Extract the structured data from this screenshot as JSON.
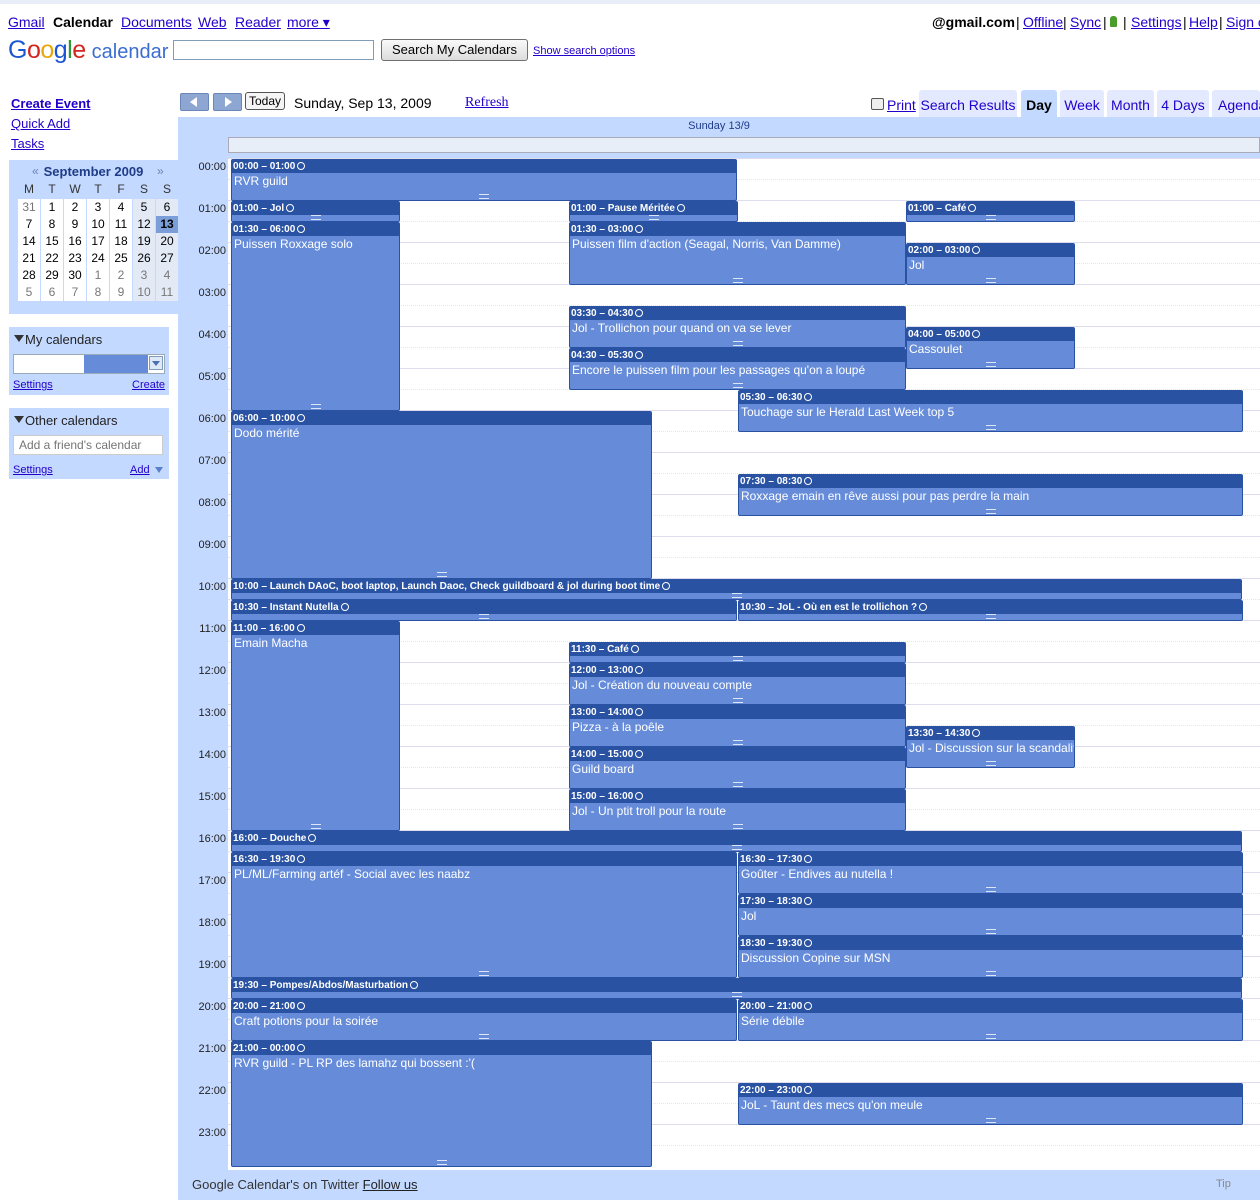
{
  "topbar": {
    "links": [
      "Gmail",
      "Calendar",
      "Documents",
      "Web",
      "Reader",
      "more ▾"
    ],
    "account": "@gmail.com",
    "right_links": [
      "Offline",
      "Sync",
      "Settings",
      "Help",
      "Sign out"
    ]
  },
  "header": {
    "logo_google": [
      "G",
      "o",
      "o",
      "g",
      "l",
      "e"
    ],
    "logo_calendar": "calendar",
    "search_button": "Search My Calendars",
    "show_options": "Show search options"
  },
  "sidebar": {
    "create_event": "Create Event",
    "quick_add": "Quick Add",
    "tasks": "Tasks",
    "minical": {
      "month": "September 2009",
      "prev": "«",
      "next": "»",
      "weekdays": [
        "M",
        "T",
        "W",
        "T",
        "F",
        "S",
        "S"
      ],
      "weeks": [
        [
          "31",
          "1",
          "2",
          "3",
          "4",
          "5",
          "6"
        ],
        [
          "7",
          "8",
          "9",
          "10",
          "11",
          "12",
          "13"
        ],
        [
          "14",
          "15",
          "16",
          "17",
          "18",
          "19",
          "20"
        ],
        [
          "21",
          "22",
          "23",
          "24",
          "25",
          "26",
          "27"
        ],
        [
          "28",
          "29",
          "30",
          "1",
          "2",
          "3",
          "4"
        ],
        [
          "5",
          "6",
          "7",
          "8",
          "9",
          "10",
          "11"
        ]
      ]
    },
    "my_calendars": {
      "title": "My calendars",
      "settings": "Settings",
      "create": "Create"
    },
    "other_calendars": {
      "title": "Other calendars",
      "placeholder": "Add a friend's calendar",
      "settings": "Settings",
      "add": "Add"
    }
  },
  "toolbar": {
    "today": "Today",
    "date": "Sunday, Sep 13, 2009",
    "refresh": "Refresh",
    "print": "Print",
    "tabs": [
      "Search Results",
      "Day",
      "Week",
      "Month",
      "4 Days",
      "Agenda"
    ],
    "active_tab": "Day"
  },
  "day": {
    "header": "Sunday 13/9",
    "hours": [
      "00:00",
      "01:00",
      "02:00",
      "03:00",
      "04:00",
      "05:00",
      "06:00",
      "07:00",
      "08:00",
      "09:00",
      "10:00",
      "11:00",
      "12:00",
      "13:00",
      "14:00",
      "15:00",
      "16:00",
      "17:00",
      "18:00",
      "19:00",
      "20:00",
      "21:00",
      "22:00",
      "23:00"
    ],
    "events": [
      {
        "time": "00:00 – 01:00",
        "title": "RVR guild",
        "start": 0,
        "end": 1,
        "col": 0,
        "span": 3
      },
      {
        "time": "01:00 – Jol",
        "title": "",
        "start": 1,
        "end": 1.5,
        "col": 0,
        "span": 1
      },
      {
        "time": "01:00 – Pause Méritée",
        "title": "",
        "start": 1,
        "end": 1.5,
        "col": 1,
        "span": 1
      },
      {
        "time": "01:00 – Café",
        "title": "",
        "start": 1,
        "end": 1.5,
        "col": 2,
        "span": 1
      },
      {
        "time": "01:30 – 06:00",
        "title": "Puissen Roxxage solo",
        "start": 1.5,
        "end": 6,
        "col": 0,
        "span": 1
      },
      {
        "time": "01:30 – 03:00",
        "title": "Puissen film d'action (Seagal, Norris, Van Damme)",
        "start": 1.5,
        "end": 3,
        "col": 1,
        "span": 2
      },
      {
        "time": "02:00 – 03:00",
        "title": "Jol",
        "start": 2,
        "end": 3,
        "col": 2,
        "span": 1
      },
      {
        "time": "03:30 – 04:30",
        "title": "Jol - Trollichon pour quand on va se lever",
        "start": 3.5,
        "end": 4.5,
        "col": 1,
        "span": 2
      },
      {
        "time": "04:00 – 05:00",
        "title": "Cassoulet",
        "start": 4,
        "end": 5,
        "col": 2,
        "span": 1
      },
      {
        "time": "04:30 – 05:30",
        "title": "Encore le puissen film pour les passages qu'on a loupé",
        "start": 4.5,
        "end": 5.5,
        "col": 1,
        "span": 2
      },
      {
        "time": "05:30 – 06:30",
        "title": "Touchage sur le Herald Last Week top 5",
        "start": 5.5,
        "end": 6.5,
        "col": 3,
        "span": 3
      },
      {
        "time": "06:00 – 10:00",
        "title": "Dodo mérité",
        "start": 6,
        "end": 10,
        "col": 0,
        "span": 2.5
      },
      {
        "time": "07:30 – 08:30",
        "title": "Roxxage emain en rêve aussi pour pas perdre la main",
        "start": 7.5,
        "end": 8.5,
        "col": 3,
        "span": 3
      },
      {
        "time": "10:00 – Launch DAoC, boot laptop, Launch Daoc, Check guildboard & jol during boot time",
        "title": "",
        "start": 10,
        "end": 10.5,
        "col": 0,
        "span": 6
      },
      {
        "time": "10:30 – Instant Nutella",
        "title": "",
        "start": 10.5,
        "end": 11,
        "col": 0,
        "span": 3
      },
      {
        "time": "10:30 – JoL - Où en est le trollichon ?",
        "title": "",
        "start": 10.5,
        "end": 11,
        "col": 3,
        "span": 3
      },
      {
        "time": "11:00 – 16:00",
        "title": "Emain Macha",
        "start": 11,
        "end": 16,
        "col": 0,
        "span": 1
      },
      {
        "time": "11:30 – Café",
        "title": "",
        "start": 11.5,
        "end": 12,
        "col": 1,
        "span": 2
      },
      {
        "time": "12:00 – 13:00",
        "title": "Jol - Création du nouveau compte",
        "start": 12,
        "end": 13,
        "col": 1,
        "span": 2
      },
      {
        "time": "13:00 – 14:00",
        "title": "Pizza - à la poêle",
        "start": 13,
        "end": 14,
        "col": 1,
        "span": 2
      },
      {
        "time": "13:30 – 14:30",
        "title": "Jol - Discussion sur la scandalifiante modération",
        "start": 13.5,
        "end": 14.5,
        "col": 2,
        "span": 1
      },
      {
        "time": "14:00 – 15:00",
        "title": "Guild board",
        "start": 14,
        "end": 15,
        "col": 1,
        "span": 2
      },
      {
        "time": "15:00 – 16:00",
        "title": "Jol - Un ptit troll pour la route",
        "start": 15,
        "end": 16,
        "col": 1,
        "span": 2
      },
      {
        "time": "16:00 – Douche",
        "title": "",
        "start": 16,
        "end": 16.5,
        "col": 0,
        "span": 6
      },
      {
        "time": "16:30 – 19:30",
        "title": "PL/ML/Farming artéf - Social avec les naabz",
        "start": 16.5,
        "end": 19.5,
        "col": 0,
        "span": 3
      },
      {
        "time": "16:30 – 17:30",
        "title": "Goûter - Endives au nutella !",
        "start": 16.5,
        "end": 17.5,
        "col": 3,
        "span": 3
      },
      {
        "time": "17:30 – 18:30",
        "title": "Jol",
        "start": 17.5,
        "end": 18.5,
        "col": 3,
        "span": 3
      },
      {
        "time": "18:30 – 19:30",
        "title": "Discussion Copine sur MSN",
        "start": 18.5,
        "end": 19.5,
        "col": 3,
        "span": 3
      },
      {
        "time": "19:30 – Pompes/Abdos/Masturbation",
        "title": "",
        "start": 19.5,
        "end": 20,
        "col": 0,
        "span": 6
      },
      {
        "time": "20:00 – 21:00",
        "title": "Craft potions pour la soirée",
        "start": 20,
        "end": 21,
        "col": 0,
        "span": 3
      },
      {
        "time": "20:00 – 21:00",
        "title": "Série débile",
        "start": 20,
        "end": 21,
        "col": 3,
        "span": 3
      },
      {
        "time": "21:00 – 00:00",
        "title": "RVR guild - PL RP des lamahz qui bossent :'(",
        "start": 21,
        "end": 24,
        "col": 0,
        "span": 2.5
      },
      {
        "time": "22:00 – 23:00",
        "title": "JoL - Taunt des mecs qu'on meule",
        "start": 22,
        "end": 23,
        "col": 3,
        "span": 3
      }
    ]
  },
  "footer": {
    "text": "Google Calendar's on Twitter",
    "link": "Follow us",
    "tip": "Tip"
  },
  "colors": {
    "event_bg": "#668cd9",
    "event_header": "#2952a3",
    "frame": "#c3d9ff"
  }
}
